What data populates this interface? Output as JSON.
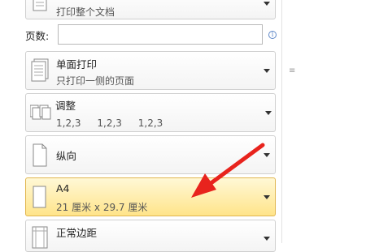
{
  "print_what": {
    "subtitle": "打印整个文档"
  },
  "pages": {
    "label": "页数:",
    "value": "",
    "placeholder": ""
  },
  "sides": {
    "title": "单面打印",
    "subtitle": "只打印一侧的页面"
  },
  "collate": {
    "title": "调整",
    "sequences": [
      "1,2,3",
      "1,2,3",
      "1,2,3"
    ]
  },
  "orientation": {
    "title": "纵向"
  },
  "paper": {
    "title": "A4",
    "subtitle": "21 厘米 x 29.7 厘米"
  },
  "margins": {
    "title": "正常边距"
  },
  "colors": {
    "selected_border": "#e0b54d",
    "selected_fill": "#ffe48a",
    "annotation_arrow": "#e8231d"
  }
}
